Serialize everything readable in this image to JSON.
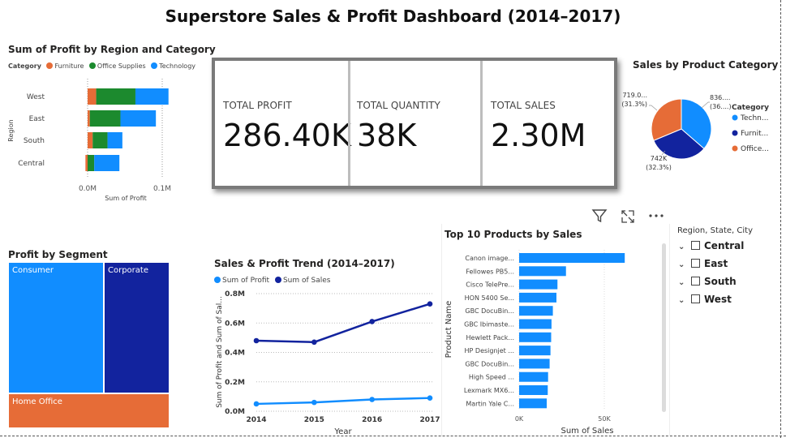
{
  "dashboard": {
    "title": "Superstore Sales & Profit Dashboard (2014–2017)"
  },
  "kpis": [
    {
      "label": "TOTAL PROFIT",
      "value": "286.40K"
    },
    {
      "label": "TOTAL QUANTITY",
      "value": "38K"
    },
    {
      "label": "TOTAL SALES",
      "value": "2.30M"
    }
  ],
  "visual_header": {
    "icons": [
      "filter-icon",
      "focus-mode-icon",
      "more-options-icon"
    ]
  },
  "slicer": {
    "title": "Region, State, City",
    "items": [
      "Central",
      "East",
      "South",
      "West"
    ]
  },
  "colors": {
    "furniture": "#e66c37",
    "office_supplies": "#1c8a2e",
    "technology": "#118dff",
    "dark_blue": "#12239e"
  },
  "chart_data": [
    {
      "type": "bar",
      "orientation": "horizontal",
      "stacked": true,
      "title": "Sum of Profit by Region and Category",
      "legend_title": "Category",
      "categories": [
        "West",
        "East",
        "South",
        "Central"
      ],
      "series": [
        {
          "name": "Furniture",
          "values": [
            11.5,
            3.0,
            6.8,
            -2.9
          ]
        },
        {
          "name": "Office Supplies",
          "values": [
            52.6,
            41.0,
            19.9,
            8.9
          ]
        },
        {
          "name": "Technology",
          "values": [
            44.3,
            47.5,
            19.9,
            33.7
          ]
        }
      ],
      "xlabel": "Sum of Profit",
      "ylabel": "Region",
      "xticks": [
        "0.0M",
        "0.1M"
      ],
      "xlim": [
        -0.003,
        0.115
      ],
      "unit_note": "values in thousands"
    },
    {
      "type": "pie",
      "title": "Sales by Product Category",
      "legend_title": "Category",
      "slices": [
        {
          "name": "Techn...",
          "value": 836,
          "label_top": "836....",
          "label_bot": "(36....)"
        },
        {
          "name": "Furnit...",
          "value": 742,
          "label_top": "742K",
          "label_bot": "(32.3%)"
        },
        {
          "name": "Office...",
          "value": 719,
          "label_top": "719.0...",
          "label_bot": "(31.3%)"
        }
      ]
    },
    {
      "type": "treemap",
      "title": "Profit by Segment",
      "items": [
        {
          "name": "Consumer",
          "value": 134
        },
        {
          "name": "Corporate",
          "value": 92
        },
        {
          "name": "Home Office",
          "value": 60
        }
      ]
    },
    {
      "type": "line",
      "title": "Sales & Profit Trend (2014–2017)",
      "x": [
        "2014",
        "2015",
        "2016",
        "2017"
      ],
      "series": [
        {
          "name": "Sum of Profit",
          "values": [
            0.05,
            0.06,
            0.08,
            0.09
          ]
        },
        {
          "name": "Sum of Sales",
          "values": [
            0.48,
            0.47,
            0.61,
            0.73
          ]
        }
      ],
      "xlabel": "Year",
      "ylabel": "Sum of Profit and Sum of Sal...",
      "yticks": [
        "0.0M",
        "0.2M",
        "0.4M",
        "0.6M",
        "0.8M"
      ],
      "ylim": [
        0,
        0.8
      ],
      "grid": true
    },
    {
      "type": "bar",
      "orientation": "horizontal",
      "title": "Top 10 Products by Sales",
      "categories": [
        "Canon image...",
        "Fellowes PB5...",
        "Cisco TelePre...",
        "HON 5400 Se...",
        "GBC DocuBin...",
        "GBC Ibimaste...",
        "Hewlett Pack...",
        "HP Designjet ...",
        "GBC DocuBin...",
        "High Speed ...",
        "Lexmark MX6...",
        "Martin Yale C..."
      ],
      "values": [
        62,
        27.5,
        22.5,
        21.9,
        19.8,
        19.0,
        18.8,
        18.4,
        17.9,
        17.0,
        16.8,
        16.2
      ],
      "xlabel": "Sum of Sales",
      "ylabel": "Product Name",
      "xticks": [
        "0K",
        "50K"
      ],
      "xlim": [
        0,
        82
      ],
      "unit_note": "values in thousands"
    }
  ]
}
